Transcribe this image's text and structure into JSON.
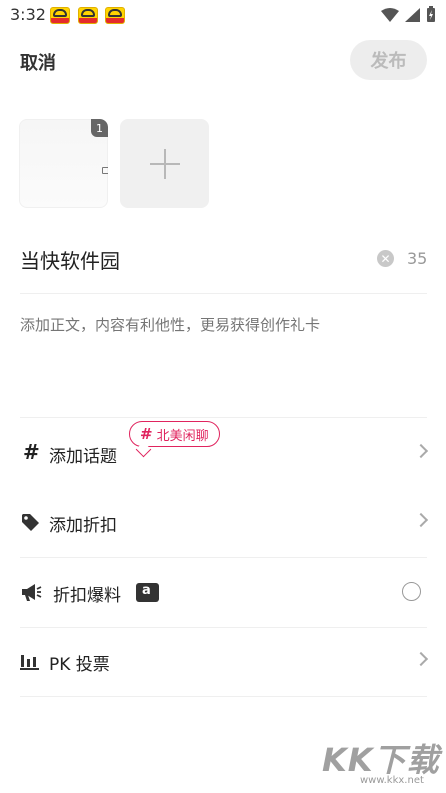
{
  "status_bar": {
    "time": "3:32"
  },
  "top_bar": {
    "cancel_label": "取消",
    "publish_label": "发布"
  },
  "photos": {
    "first_badge": "1"
  },
  "title_field": {
    "value": "当快软件园",
    "char_count": "35"
  },
  "body_field": {
    "placeholder": "添加正文，内容有利他性，更易获得创作礼卡"
  },
  "options": [
    {
      "label": "添加话题",
      "icon": "hashtag-icon"
    },
    {
      "label": "添加折扣",
      "icon": "price-tag-icon"
    },
    {
      "label": "折扣爆料",
      "icon": "megaphone-icon",
      "badge": "a"
    },
    {
      "label": "PK 投票",
      "icon": "bar-chart-icon"
    }
  ],
  "topic_suggestion": {
    "hash": "#",
    "label": "北美闲聊"
  },
  "watermark": {
    "main": "KK下载",
    "sub": "www.kkx.net"
  },
  "colors": {
    "accent": "#e0245e",
    "publish_disabled_bg": "#ededed",
    "publish_disabled_text": "#bbbbbb"
  }
}
